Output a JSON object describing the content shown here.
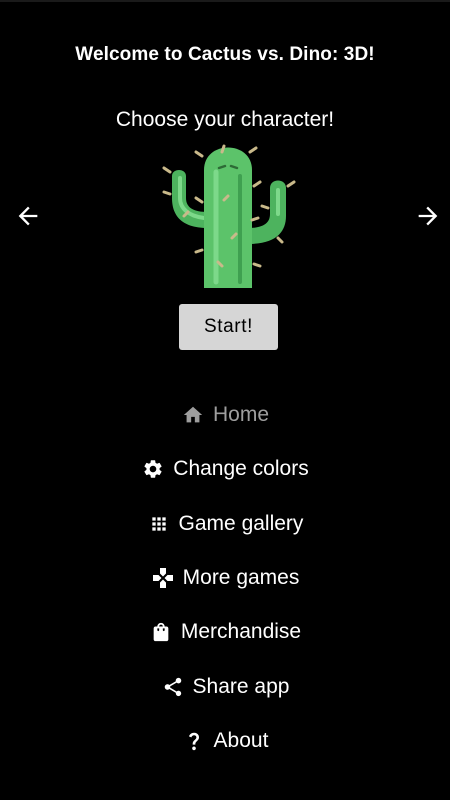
{
  "header": {
    "title": "Welcome to Cactus vs. Dino: 3D!",
    "subtitle": "Choose your character!"
  },
  "character_selector": {
    "prev_icon": "arrow-left-icon",
    "next_icon": "arrow-right-icon",
    "selected_character": "cactus"
  },
  "start_button": {
    "label": "Start!"
  },
  "menu": {
    "items": [
      {
        "label": "Home",
        "icon": "home-icon",
        "active": true
      },
      {
        "label": "Change colors",
        "icon": "gear-icon",
        "active": false
      },
      {
        "label": "Game gallery",
        "icon": "grid-icon",
        "active": false
      },
      {
        "label": "More games",
        "icon": "gamepad-icon",
        "active": false
      },
      {
        "label": "Merchandise",
        "icon": "shopping-bag-icon",
        "active": false
      },
      {
        "label": "Share app",
        "icon": "share-icon",
        "active": false
      },
      {
        "label": "About",
        "icon": "question-mark-icon",
        "active": false
      }
    ]
  },
  "colors": {
    "background": "#000000",
    "text": "#ffffff",
    "active_menu_text": "#9e9e9e",
    "button_bg": "#d6d6d6",
    "cactus_green": "#5cc36a"
  }
}
